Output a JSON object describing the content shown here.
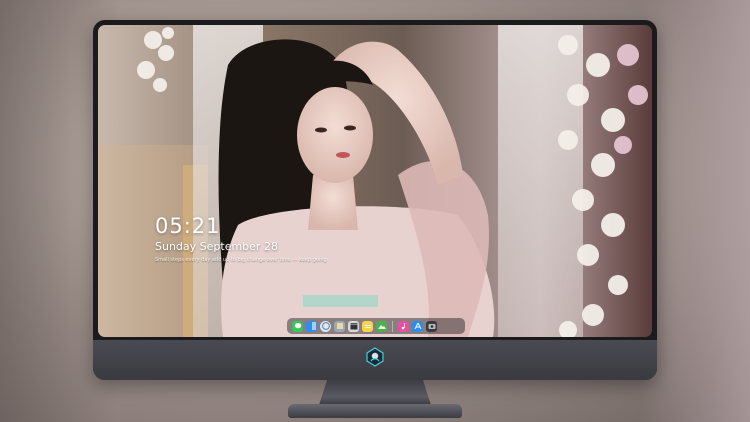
{
  "lockscreen": {
    "time": "05:21",
    "date": "Sunday September  28",
    "subtitle": "Small steps every day add up to big change over time — keep going"
  },
  "dock": {
    "items": [
      {
        "name": "messages-icon",
        "color": "#34c759"
      },
      {
        "name": "finder-icon",
        "color": "#2f8cf0"
      },
      {
        "name": "safari-icon",
        "color": "#e6e6e6"
      },
      {
        "name": "preview-icon",
        "color": "#9aa7b4"
      },
      {
        "name": "clapper-icon",
        "color": "#d8d8d8"
      },
      {
        "name": "notes-icon",
        "color": "#f7d44c"
      },
      {
        "name": "photos-icon",
        "color": "#4caf50"
      },
      {
        "name": "itunes-icon",
        "color": "#e94fa1"
      },
      {
        "name": "appstore-icon",
        "color": "#2d8cf0"
      },
      {
        "name": "camera-icon",
        "color": "#3a3a3f"
      }
    ]
  },
  "colors": {
    "bezel": "#1b1b1e",
    "chin": "#3a3a41",
    "logo_accent": "#3fd0d8"
  }
}
